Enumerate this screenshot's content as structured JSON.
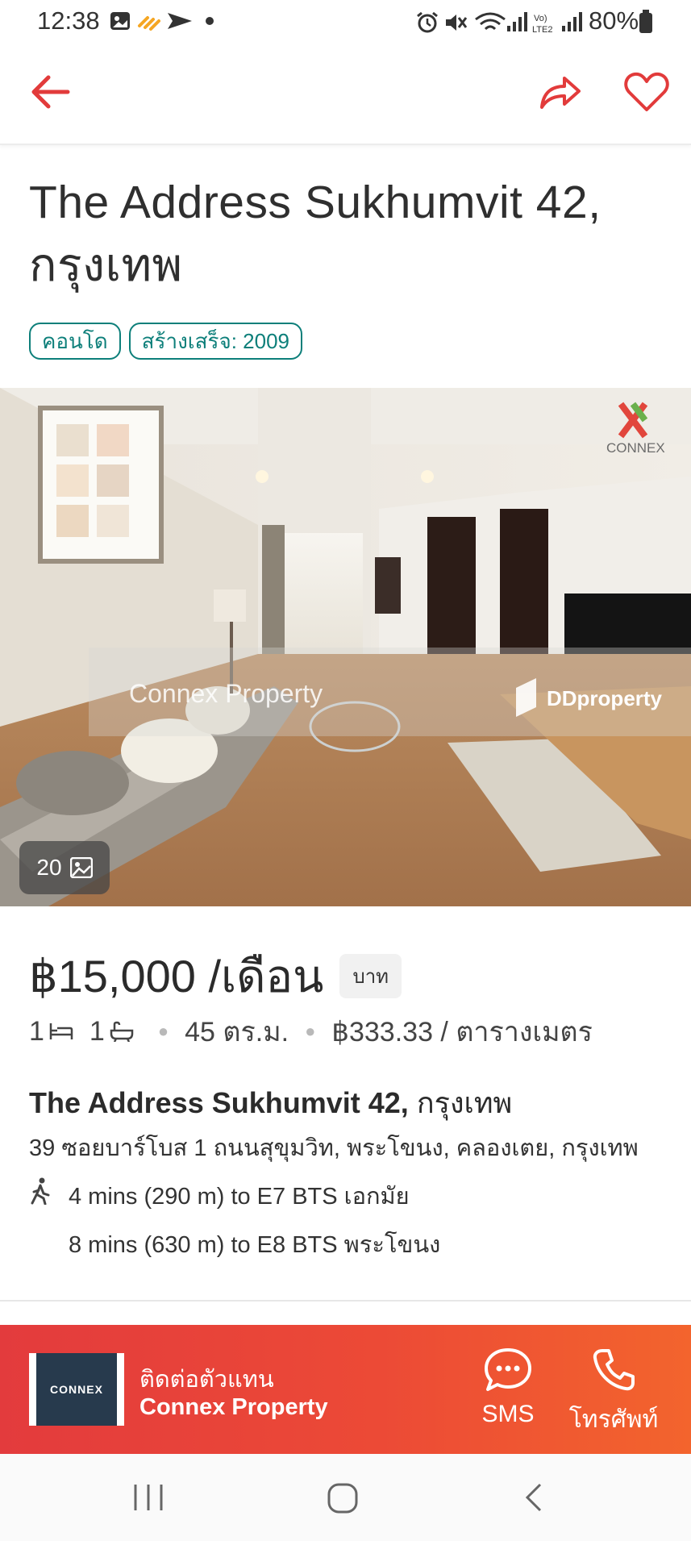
{
  "status_bar": {
    "time": "12:38",
    "battery": "80%"
  },
  "listing": {
    "title": "The Address Sukhumvit 42, กรุงเทพ",
    "tags": [
      "คอนโด",
      "สร้างเสร็จ: 2009"
    ],
    "photo_count": "20",
    "watermarks": {
      "left": "Connex Property",
      "right": "DDproperty",
      "logo": "CONNEX"
    },
    "price": "฿15,000 /เดือน",
    "currency": "บาท",
    "beds": "1",
    "baths": "1",
    "area": "45 ตร.ม.",
    "price_per_sqm": "฿333.33 / ตารางเมตร",
    "project_name": "The Address Sukhumvit 42,",
    "project_city": "กรุงเทพ",
    "address": "39  ซอยบาร์โบส 1 ถนนสุขุมวิท, พระโขนง, คลองเตย, กรุงเทพ",
    "transit": [
      "4 mins (290 m) to E7 BTS เอกมัย",
      "8 mins (630 m) to E8 BTS พระโขนง"
    ]
  },
  "contact_bar": {
    "label": "ติดต่อตัวแทน",
    "agent_name": "Connex Property",
    "agent_logo_text": "CONNEX",
    "sms_label": "SMS",
    "call_label": "โทรศัพท์"
  },
  "colors": {
    "accent": "#e33b3d",
    "teal": "#0d7f7a"
  }
}
